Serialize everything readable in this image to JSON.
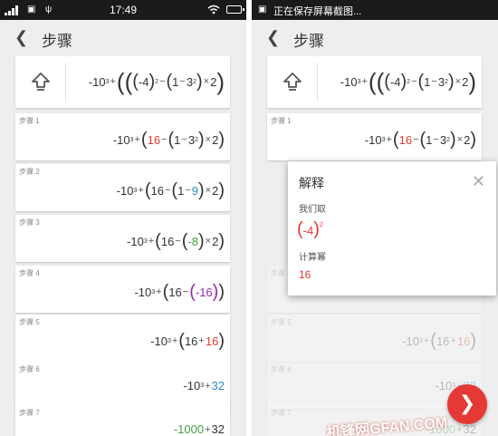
{
  "statusbar": {
    "time": "17:49",
    "notification": "正在保存屏幕截图..."
  },
  "appbar": {
    "back_icon": "chevron-left-icon",
    "title": "步骤"
  },
  "equation": {
    "minus": "-",
    "ten": "10",
    "cube": "3",
    "plus": "+",
    "neg4": "-4",
    "sq": "2",
    "one": "1",
    "three": "3",
    "times": "×",
    "two": "2"
  },
  "steps": [
    {
      "label": "步骤 1",
      "value": "16"
    },
    {
      "label": "步骤 2",
      "value": "9"
    },
    {
      "label": "步骤 3",
      "value": "-8"
    },
    {
      "label": "步骤 4",
      "value": "-16"
    },
    {
      "label": "步骤 5",
      "value": "16"
    },
    {
      "label": "步骤 6",
      "value": "32"
    },
    {
      "label": "步骤 7",
      "left": "-1000",
      "value": "32"
    }
  ],
  "popup": {
    "title": "解释",
    "line1": "我们取",
    "expr": "-4",
    "exp": "2",
    "line2": "计算幂",
    "result": "16"
  },
  "fab": {
    "icon": "chevron-right-icon"
  },
  "watermark": "机锋网GFAN.COM",
  "colors": {
    "red": "#e53935",
    "blue": "#2b8ccd",
    "green": "#43a047",
    "purple": "#9c27b0"
  }
}
